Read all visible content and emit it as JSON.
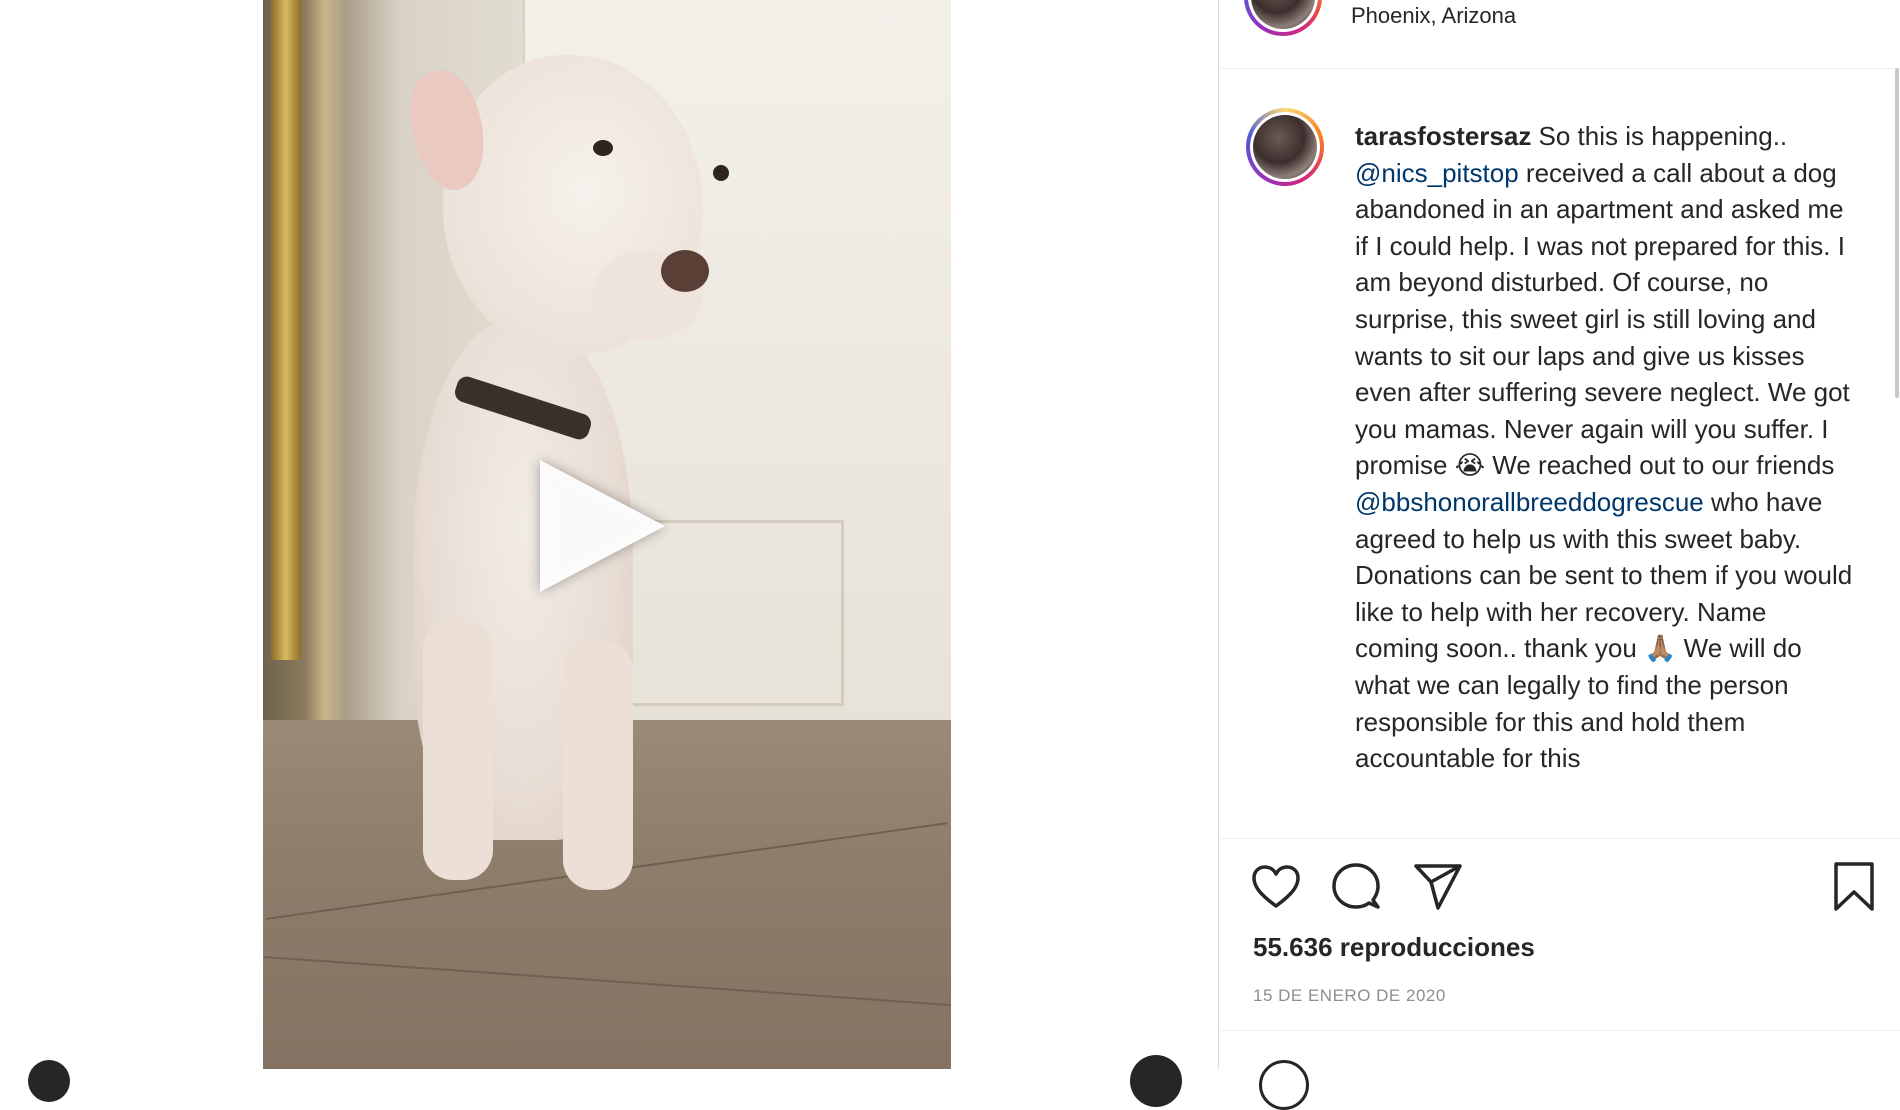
{
  "header": {
    "location": "Phoenix, Arizona"
  },
  "caption": {
    "username": "tarasfostersaz",
    "part1": " So this is happening.. ",
    "mention1": "@nics_pitstop",
    "part2": " received a call about a dog abandoned in an apartment and asked me if I could help. I was not prepared for this. I am beyond disturbed. Of course, no surprise, this sweet girl is still loving and wants to sit our laps and give us kisses even after suffering severe neglect. We got you mamas. Never again will you suffer. I promise 😭 We reached out to our friends ",
    "mention2": "@bbshonorallbreeddogrescue",
    "part3": " who have agreed to help us with this sweet baby. Donations can be sent to them if you would like to help with her recovery. Name coming soon.. thank you 🙏🏽 We will do what we can legally to find the person responsible for this and hold them accountable for this"
  },
  "stats": {
    "views": "55.636 reproducciones",
    "date": "15 DE ENERO DE 2020"
  },
  "icons": {
    "play": "play-icon",
    "like": "heart-icon",
    "comment": "comment-icon",
    "share": "paper-plane-icon",
    "save": "bookmark-icon"
  },
  "colors": {
    "mention": "#00376b",
    "text": "#262626",
    "muted": "#8e8e8e"
  }
}
